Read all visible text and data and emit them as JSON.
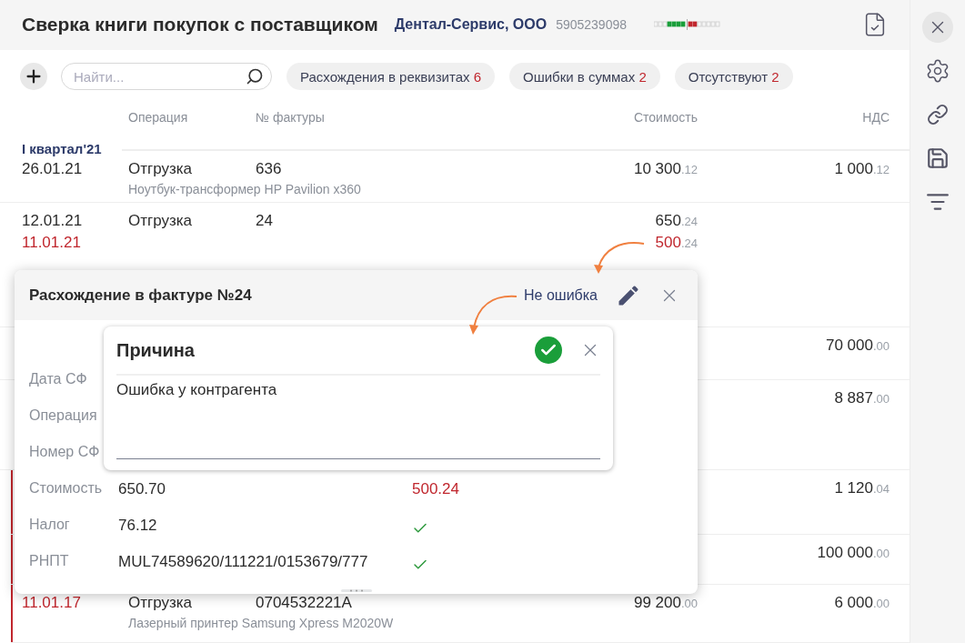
{
  "header": {
    "title": "Сверка книги покупок с поставщиком",
    "company": "Дентал-Сервис, ООО",
    "inn": "5905239098"
  },
  "toolbar": {
    "search": {
      "placeholder": "Найти..."
    },
    "filters": [
      {
        "label": "Расхождения в реквизитах",
        "count": "6"
      },
      {
        "label": "Ошибки в суммах",
        "count": "2"
      },
      {
        "label": "Отсутствуют",
        "count": "2"
      }
    ]
  },
  "table": {
    "columns": [
      "Операция",
      "№ фактуры",
      "Стоимость",
      "НДС"
    ],
    "group": "I квартал'21",
    "rows": [
      {
        "dates": [
          {
            "text": "26.01.21",
            "mismatch": false
          }
        ],
        "operation": "Отгрузка",
        "invoice": "636",
        "description": "Ноутбук-трансформер HP Pavilion x360",
        "cost": [
          {
            "int": "10 300",
            "dec": ".12",
            "mismatch": false
          }
        ],
        "vat": {
          "int": "1 000",
          "dec": ".12"
        },
        "flagged": false
      },
      {
        "dates": [
          {
            "text": "12.01.21",
            "mismatch": false
          },
          {
            "text": "11.01.21",
            "mismatch": true
          }
        ],
        "operation": "Отгрузка",
        "invoice": "24",
        "cost": [
          {
            "int": "650",
            "dec": ".24",
            "mismatch": false
          },
          {
            "int": "500",
            "dec": ".24",
            "mismatch": true
          }
        ],
        "flagged": false
      },
      {
        "vat": {
          "int": "70 000",
          "dec": ".00"
        },
        "flagged": false
      },
      {
        "vat": {
          "int": "8 887",
          "dec": ".00"
        },
        "flagged": false
      },
      {
        "vat": {
          "int": "1 120",
          "dec": ".04"
        },
        "flagged": true
      },
      {
        "vat": {
          "int": "100 000",
          "dec": ".00"
        },
        "flagged": true
      },
      {
        "dates": [
          {
            "text": "11.01.17",
            "mismatch": true
          }
        ],
        "operation": "Отгрузка",
        "invoice": "0704532221А",
        "description": "Лазерный принтер Samsung Xpress M2020W",
        "cost": [
          {
            "int": "99 200",
            "dec": ".00",
            "mismatch": false
          }
        ],
        "vat": {
          "int": "6 000",
          "dec": ".00"
        },
        "flagged": true
      }
    ]
  },
  "discrepancy_popup": {
    "title": "Расхождение в фактуре №24",
    "action": "Не ошибка",
    "fields": [
      {
        "label": "Дата СФ"
      },
      {
        "label": "Операция"
      },
      {
        "label": "Номер СФ"
      },
      {
        "label": "Стоимость",
        "value": "650.70",
        "counterparty": "500.24",
        "match": false
      },
      {
        "label": "Налог",
        "value": "76.12",
        "match": true
      },
      {
        "label": "РНПТ",
        "value": "MUL74589620/111221/0153679/777",
        "match": true
      }
    ]
  },
  "reason_popup": {
    "title": "Причина",
    "value": "Ошибка у контрагента"
  }
}
